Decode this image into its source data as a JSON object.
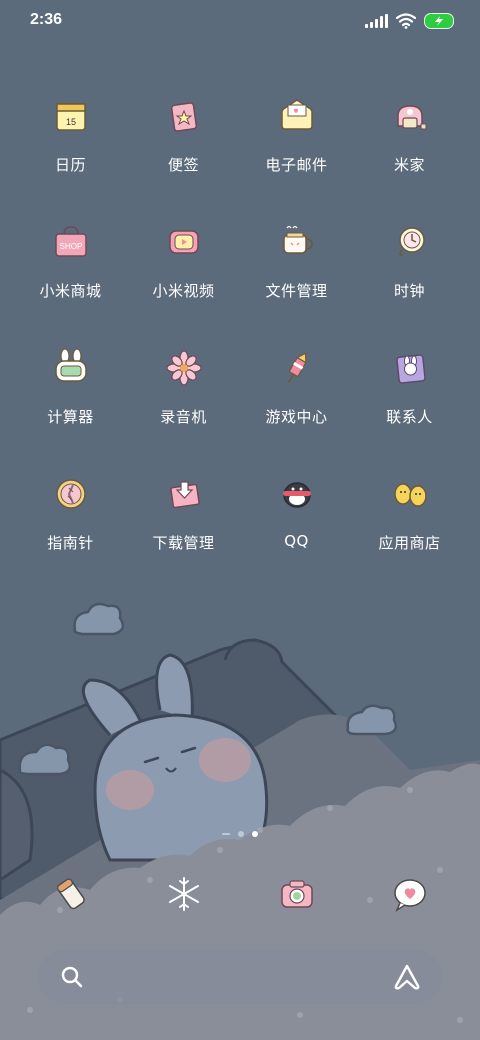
{
  "status_bar": {
    "time": "2:36"
  },
  "apps": [
    {
      "label": "日历",
      "icon": "calendar-icon",
      "icon_text": "15"
    },
    {
      "label": "便签",
      "icon": "notes-icon"
    },
    {
      "label": "电子邮件",
      "icon": "email-icon"
    },
    {
      "label": "米家",
      "icon": "mijia-icon"
    },
    {
      "label": "小米商城",
      "icon": "shop-icon",
      "icon_text": "SHOP"
    },
    {
      "label": "小米视频",
      "icon": "video-icon"
    },
    {
      "label": "文件管理",
      "icon": "file-manager-icon"
    },
    {
      "label": "时钟",
      "icon": "clock-icon"
    },
    {
      "label": "计算器",
      "icon": "calculator-icon"
    },
    {
      "label": "录音机",
      "icon": "recorder-icon"
    },
    {
      "label": "游戏中心",
      "icon": "game-center-icon"
    },
    {
      "label": "联系人",
      "icon": "contacts-icon"
    },
    {
      "label": "指南针",
      "icon": "compass-icon"
    },
    {
      "label": "下载管理",
      "icon": "downloads-icon"
    },
    {
      "label": "QQ",
      "icon": "qq-icon"
    },
    {
      "label": "应用商店",
      "icon": "app-store-icon"
    }
  ],
  "dock": [
    {
      "icon": "phone-icon"
    },
    {
      "icon": "messages-icon"
    },
    {
      "icon": "camera-icon"
    },
    {
      "icon": "browser-icon"
    }
  ],
  "page_indicator": {
    "pages": 3,
    "active": 2
  },
  "colors": {
    "background": "#5c6b7c",
    "text": "#ffffff",
    "bunny": "#8c9bb0",
    "battery": "#2ecc40"
  }
}
